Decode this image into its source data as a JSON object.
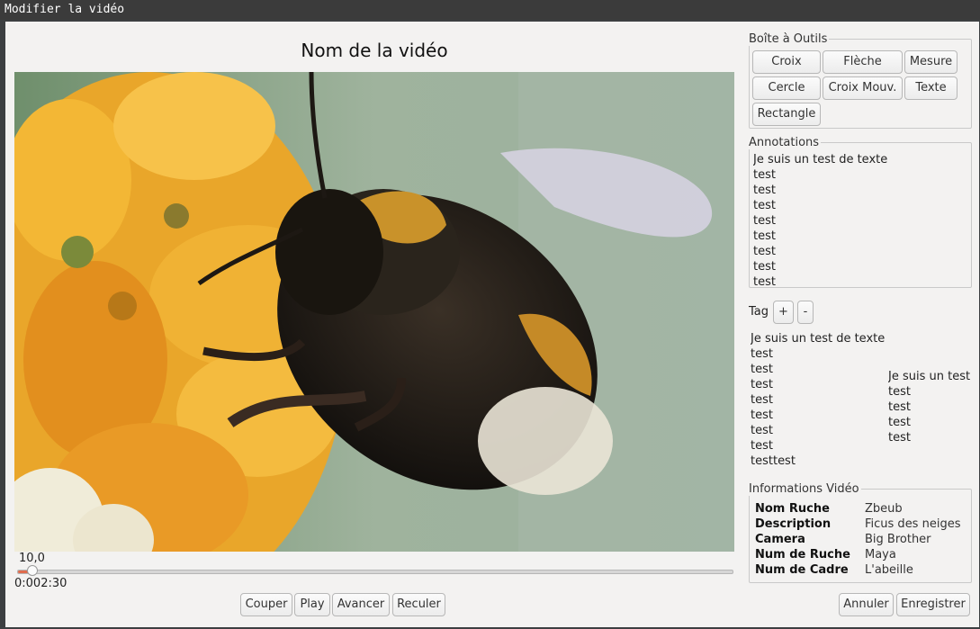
{
  "window": {
    "title": "Modifier la vidéo"
  },
  "video": {
    "name": "Nom de la vidéo",
    "slider_value": 10,
    "slider_value_label": "10,0",
    "time": "0:002:30"
  },
  "player_buttons": {
    "cut": "Couper",
    "play": "Play",
    "forward": "Avancer",
    "back": "Reculer"
  },
  "toolbox": {
    "title": "Boîte à Outils",
    "tools": [
      "Croix",
      "Flèche",
      "Mesure",
      "Cercle",
      "Croix Mouv.",
      "Texte",
      "Rectangle"
    ]
  },
  "annotations": {
    "title": "Annotations",
    "items": [
      "Je suis un test de texte",
      "test",
      "test",
      "test",
      "test",
      "test",
      "test",
      "test",
      "test"
    ]
  },
  "tags": {
    "label": "Tag",
    "add": "+",
    "remove": "-",
    "column1": [
      "Je suis un test de texte",
      "test",
      "test",
      "test",
      "test",
      "test",
      "test",
      "test",
      "testtest"
    ],
    "column2": [
      "Je suis un test",
      "test",
      "test",
      "test",
      "test"
    ]
  },
  "info": {
    "title": "Informations Vidéo",
    "rows": [
      {
        "key": "Nom Ruche",
        "value": "Zbeub"
      },
      {
        "key": "Description",
        "value": "Ficus des neiges"
      },
      {
        "key": "Camera",
        "value": "Big Brother"
      },
      {
        "key": "Num de Ruche",
        "value": "Maya"
      },
      {
        "key": "Num de Cadre",
        "value": "L'abeille"
      }
    ]
  },
  "dialog_buttons": {
    "cancel": "Annuler",
    "save": "Enregistrer"
  },
  "colors": {
    "slider_fill": "#e06d4e",
    "titlebar": "#3b3b3b",
    "window_bg": "#f3f2f1"
  }
}
